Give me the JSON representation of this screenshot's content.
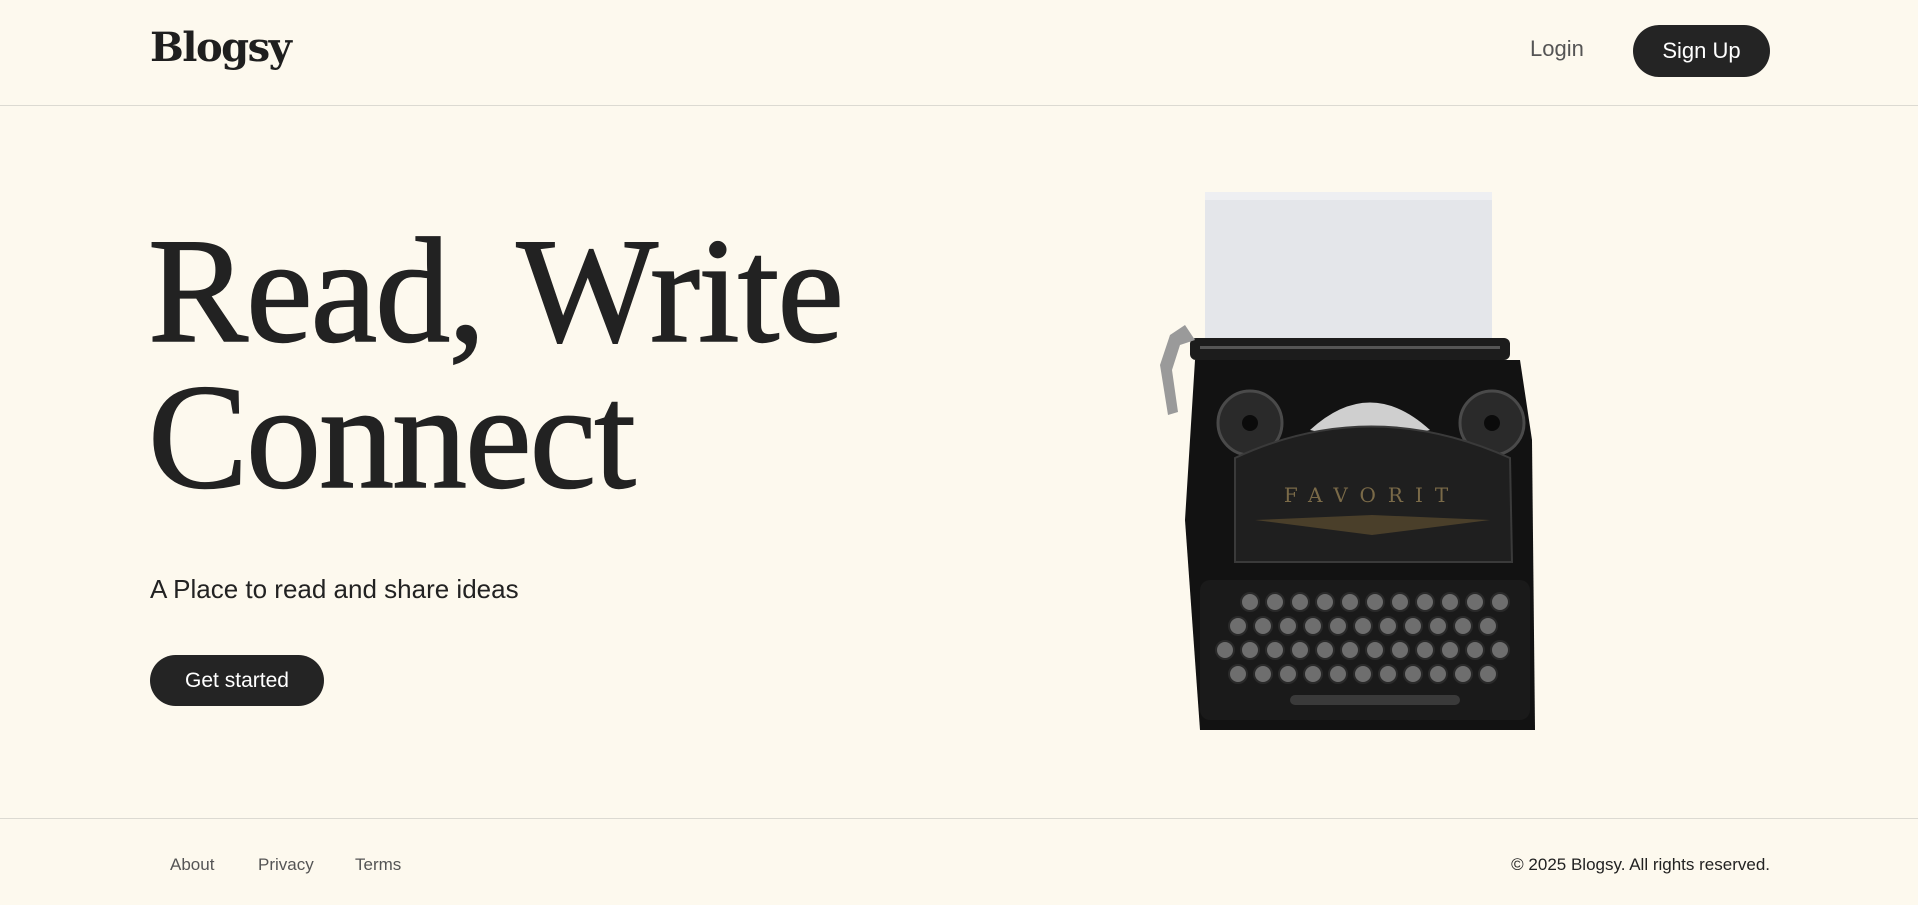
{
  "header": {
    "logo": "Blogsy",
    "login_label": "Login",
    "signup_label": "Sign Up"
  },
  "hero": {
    "title_line1": "Read, Write",
    "title_line2": "Connect",
    "subtitle": "A Place to read and share ideas",
    "cta_label": "Get started",
    "image_text": "FAVORIT"
  },
  "footer": {
    "links": [
      "About",
      "Privacy",
      "Terms"
    ],
    "copyright": "© 2025 Blogsy. All rights reserved."
  },
  "colors": {
    "background": "#fdf9ee",
    "primary_button": "#242424",
    "text": "#222222"
  },
  "icons": [
    "typewriter-illustration"
  ]
}
